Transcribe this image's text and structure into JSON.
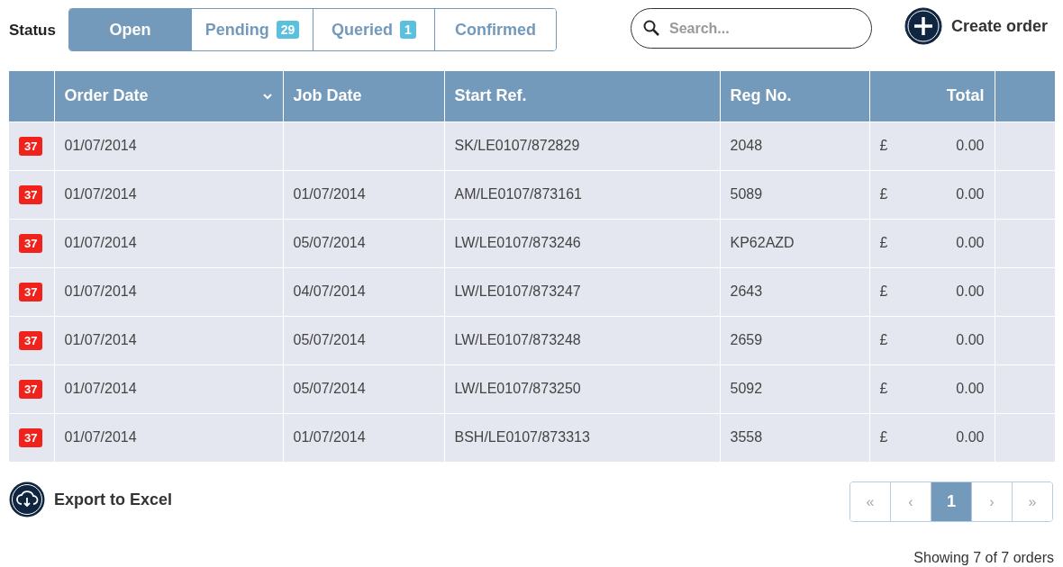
{
  "status_filter": {
    "label": "Status",
    "tabs": [
      {
        "label": "Open",
        "selected": true
      },
      {
        "label": "Pending",
        "selected": false,
        "count": "29"
      },
      {
        "label": "Queried",
        "selected": false,
        "count": "1"
      },
      {
        "label": "Confirmed",
        "selected": false
      }
    ]
  },
  "search": {
    "placeholder": "Search..."
  },
  "create_button": {
    "label": "Create order"
  },
  "table": {
    "columns": [
      {
        "label": "Order Date",
        "sorted": true
      },
      {
        "label": "Job Date",
        "sorted": false
      },
      {
        "label": "Start Ref.",
        "sorted": false
      },
      {
        "label": "Reg No.",
        "sorted": false
      },
      {
        "label": "Total",
        "sorted": false
      }
    ],
    "rows": [
      {
        "badge": "37",
        "order_date": "01/07/2014",
        "start_ref": "SK/LE0107/872829",
        "reg_no": "2048",
        "currency": "£",
        "total": "0.00"
      },
      {
        "badge": "37",
        "order_date": "01/07/2014",
        "job_date": "01/07/2014",
        "start_ref": "AM/LE0107/873161",
        "reg_no": "5089",
        "currency": "£",
        "total": "0.00"
      },
      {
        "badge": "37",
        "order_date": "01/07/2014",
        "job_date": "05/07/2014",
        "start_ref": "LW/LE0107/873246",
        "reg_no": "KP62AZD",
        "currency": "£",
        "total": "0.00"
      },
      {
        "badge": "37",
        "order_date": "01/07/2014",
        "job_date": "04/07/2014",
        "start_ref": "LW/LE0107/873247",
        "reg_no": "2643",
        "currency": "£",
        "total": "0.00"
      },
      {
        "badge": "37",
        "order_date": "01/07/2014",
        "job_date": "05/07/2014",
        "start_ref": "LW/LE0107/873248",
        "reg_no": "2659",
        "currency": "£",
        "total": "0.00"
      },
      {
        "badge": "37",
        "order_date": "01/07/2014",
        "job_date": "05/07/2014",
        "start_ref": "LW/LE0107/873250",
        "reg_no": "5092",
        "currency": "£",
        "total": "0.00"
      },
      {
        "badge": "37",
        "order_date": "01/07/2014",
        "job_date": "01/07/2014",
        "start_ref": "BSH/LE0107/873313",
        "reg_no": "3558",
        "currency": "£",
        "total": "0.00"
      }
    ]
  },
  "export_button": {
    "label": "Export to Excel"
  },
  "pagination": [
    {
      "label": "«",
      "selected": false,
      "disabled": true
    },
    {
      "label": "‹",
      "selected": false,
      "disabled": true
    },
    {
      "label": "1",
      "selected": true,
      "disabled": false
    },
    {
      "label": "›",
      "selected": false,
      "disabled": true
    },
    {
      "label": "»",
      "selected": false,
      "disabled": true
    }
  ],
  "summary": "Showing 7 of 7 orders"
}
